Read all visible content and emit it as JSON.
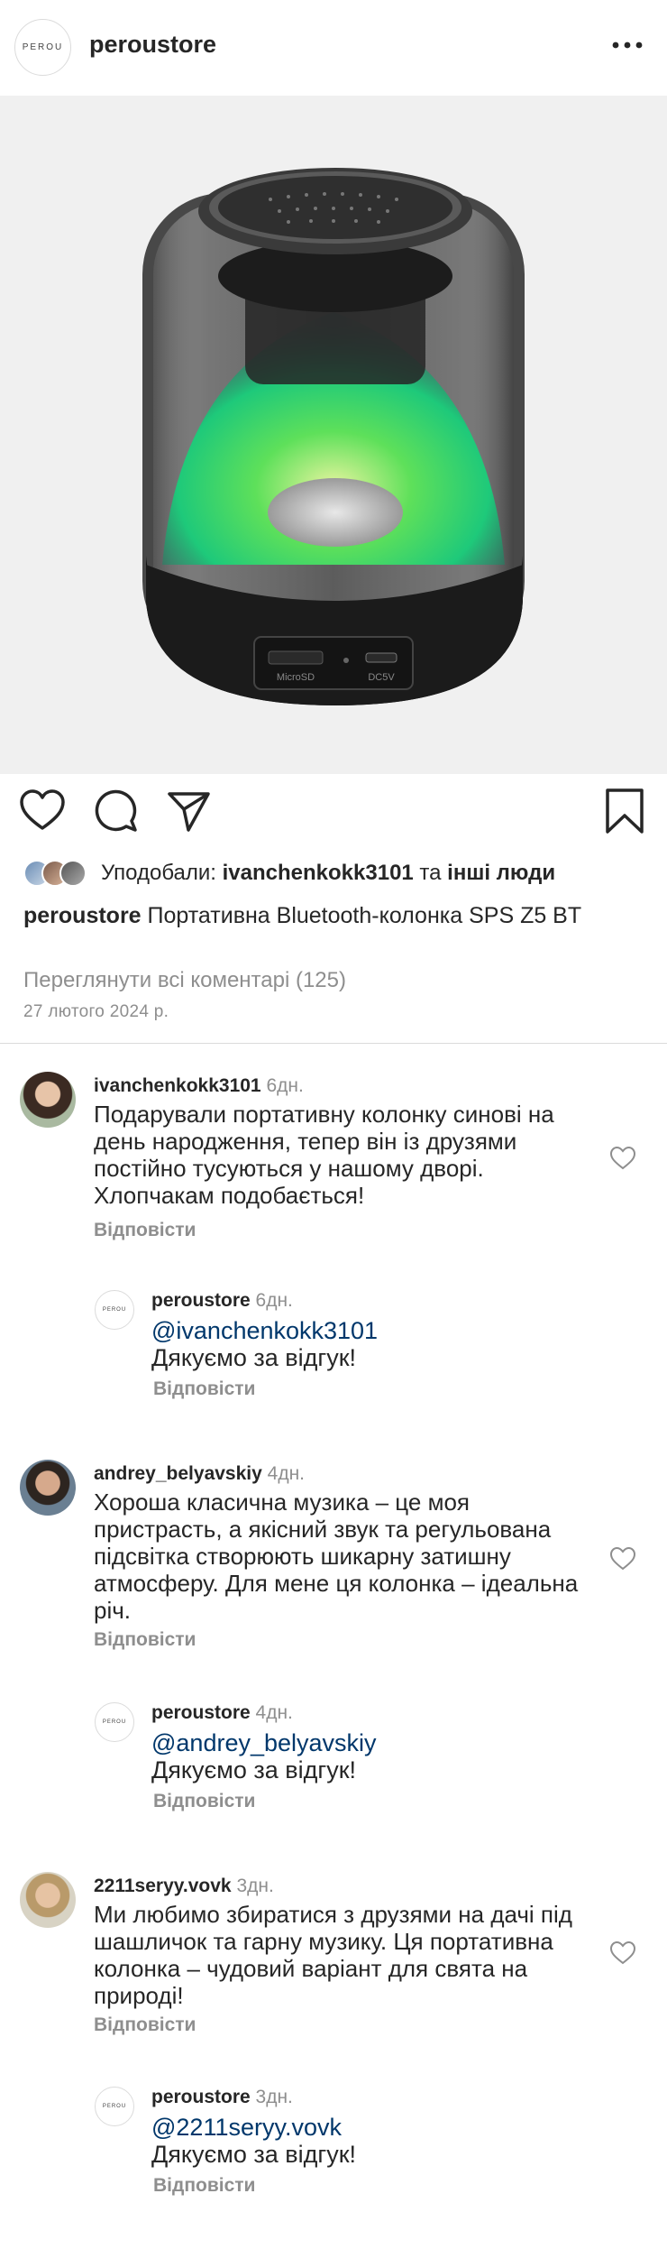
{
  "header": {
    "username": "peroustore",
    "avatar_text": "PEROU",
    "more_icon": "more-horizontal-icon"
  },
  "post": {
    "image_alt": "Портативна Bluetooth-колонка з підсвіткою",
    "speaker_port_label_left": "MicroSD",
    "speaker_port_label_right": "DC5V"
  },
  "actions": {
    "like_icon": "heart-icon",
    "comment_icon": "comment-icon",
    "share_icon": "send-icon",
    "save_icon": "bookmark-icon"
  },
  "likes": {
    "prefix": "Уподобали: ",
    "user": "ivanchenkokk3101",
    "and": " та ",
    "others": "інші люди"
  },
  "caption": {
    "username": "peroustore",
    "text": " Портативна Bluetooth-колонка SPS Z5 BT"
  },
  "view_all": "Переглянути всі коментарі (125)",
  "date": "27 лютого 2024 р.",
  "comments": [
    {
      "username": "ivanchenkokk3101",
      "time": "6дн.",
      "text": "Подарували портативну колонку синові на день народження, тепер він із друзями постійно тусуються у нашому дворі. Хлопчакам подобається!",
      "reply_label": "Відповісти",
      "reply": {
        "username": "peroustore",
        "time": "6дн.",
        "avatar_text": "PEROU",
        "mention": "@ivanchenkokk3101",
        "text": "Дякуємо за відгук!",
        "reply_label": "Відповісти"
      }
    },
    {
      "username": "andrey_belyavskiy",
      "time": "4дн.",
      "text": "Хороша класична музика – це моя пристрасть, а якісний звук та регульована підсвітка створюють шикарну затишну атмосферу. Для мене ця колонка – ідеальна річ.",
      "reply_label": "Відповісти",
      "reply": {
        "username": "peroustore",
        "time": "4дн.",
        "avatar_text": "PEROU",
        "mention": "@andrey_belyavskiy",
        "text": "Дякуємо за відгук!",
        "reply_label": "Відповісти"
      }
    },
    {
      "username": "2211seryy.vovk",
      "time": "3дн.",
      "text": "Ми любимо збиратися з друзями на дачі під шашличок та гарну музику. Ця портативна колонка – чудовий варіант для свята на природі!",
      "reply_label": "Відповісти",
      "reply": {
        "username": "peroustore",
        "time": "3дн.",
        "avatar_text": "PEROU",
        "mention": "@2211seryy.vovk",
        "text": "Дякуємо за відгук!",
        "reply_label": "Відповісти"
      }
    }
  ]
}
